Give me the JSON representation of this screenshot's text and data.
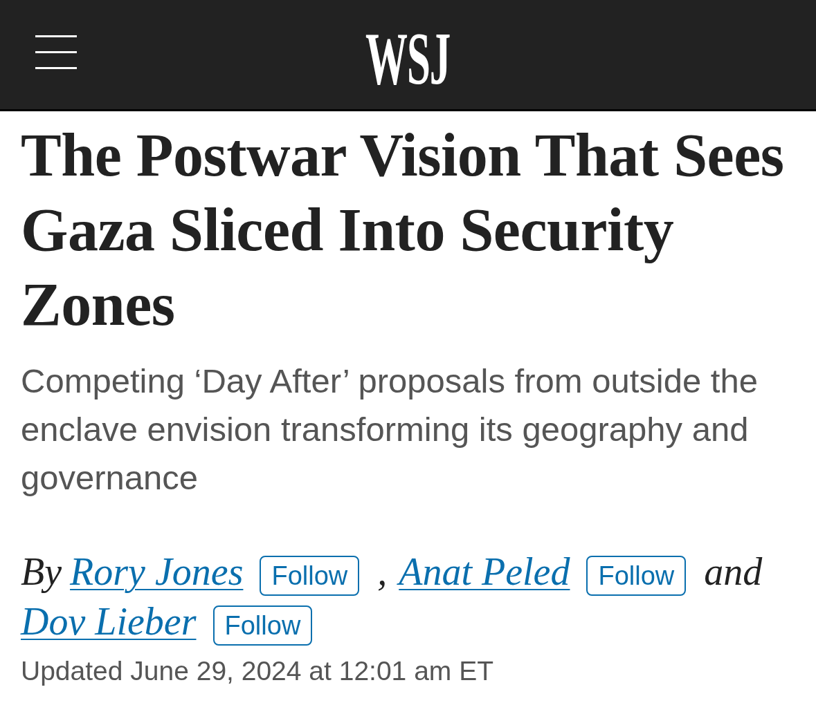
{
  "header": {
    "logo": "WSJ"
  },
  "article": {
    "headline": "The Postwar Vision That Sees Gaza Sliced Into Security Zones",
    "dek": "Competing ‘Day After’ proposals from outside the enclave envision transforming its geography and governance",
    "byline": {
      "prefix": "By",
      "authors": [
        {
          "name": "Rory Jones",
          "follow": "Follow",
          "separator": ","
        },
        {
          "name": "Anat Peled",
          "follow": "Follow",
          "separator": "and"
        },
        {
          "name": "Dov Lieber",
          "follow": "Follow"
        }
      ]
    },
    "timestamp": "Updated June 29, 2024 at 12:01 am ET"
  }
}
